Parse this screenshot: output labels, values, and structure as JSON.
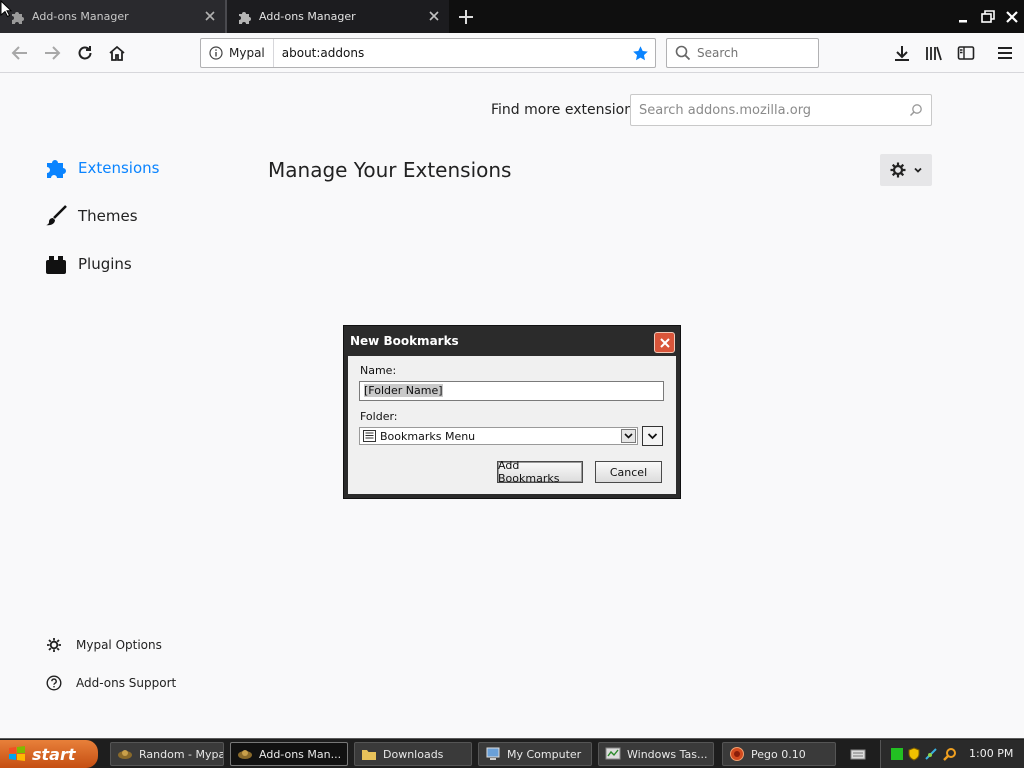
{
  "browser": {
    "tabs": [
      {
        "title": "Add-ons Manager",
        "active": false
      },
      {
        "title": "Add-ons Manager",
        "active": true
      }
    ],
    "identity_label": "Mypal",
    "url": "about:addons",
    "search_placeholder": "Search"
  },
  "addons": {
    "find_more_label": "Find more extensions",
    "find_placeholder": "Search addons.mozilla.org",
    "categories": [
      {
        "label": "Extensions",
        "selected": true
      },
      {
        "label": "Themes",
        "selected": false
      },
      {
        "label": "Plugins",
        "selected": false
      }
    ],
    "heading": "Manage Your Extensions",
    "footer_links": [
      {
        "label": "Mypal Options"
      },
      {
        "label": "Add-ons Support"
      }
    ]
  },
  "dialog": {
    "title": "New Bookmarks",
    "name_label": "Name:",
    "name_value": "[Folder Name]",
    "folder_label": "Folder:",
    "folder_value": "Bookmarks Menu",
    "add_button": "Add Bookmarks",
    "cancel_button": "Cancel"
  },
  "taskbar": {
    "start_label": "start",
    "tasks": [
      {
        "label": "Random - Mypal",
        "active": false
      },
      {
        "label": "Add-ons Man...",
        "active": true
      },
      {
        "label": "Downloads",
        "active": false
      },
      {
        "label": "My Computer",
        "active": false
      },
      {
        "label": "Windows Tas...",
        "active": false
      },
      {
        "label": "Pego 0.10",
        "active": false
      }
    ],
    "clock": "1:00 PM"
  },
  "colors": {
    "accent": "#0a84ff",
    "dialog_close": "#d9553a",
    "start_button": "#d2611e"
  }
}
